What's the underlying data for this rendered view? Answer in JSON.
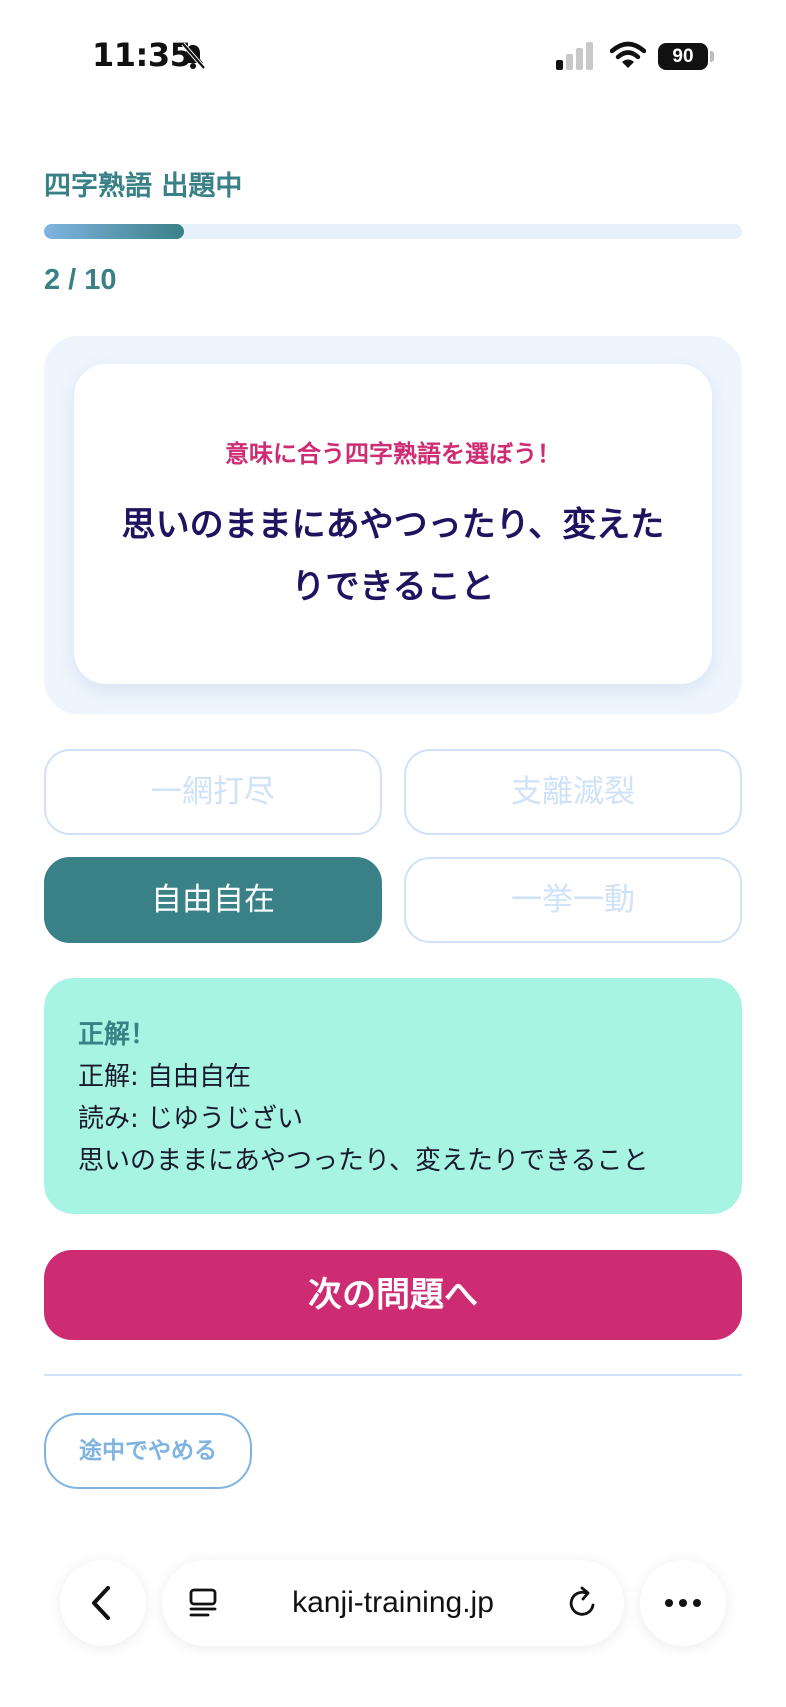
{
  "status_bar": {
    "time": "11:35",
    "battery": "90"
  },
  "quiz": {
    "title": "四字熟語 出題中",
    "progress_fraction": 0.2,
    "progress_label": "2 / 10"
  },
  "question": {
    "prompt": "意味に合う四字熟語を選ぼう！",
    "text": "思いのままにあやつったり、変えたりできること"
  },
  "choices": [
    {
      "label": "一網打尽",
      "selected": false
    },
    {
      "label": "支離滅裂",
      "selected": false
    },
    {
      "label": "自由自在",
      "selected": true
    },
    {
      "label": "一挙一動",
      "selected": false
    }
  ],
  "feedback": {
    "title": "正解！",
    "answer": "正解: 自由自在",
    "reading": "読み: じゆうじざい",
    "meaning": "思いのままにあやつったり、変えたりできること"
  },
  "next_button": "次の問題へ",
  "quit_button": "途中でやめる",
  "browser": {
    "url": "kanji-training.jp"
  },
  "colors": {
    "accent_teal": "#3a8087",
    "accent_pink": "#cd2c73",
    "feedback_bg": "#a8f4e2"
  }
}
